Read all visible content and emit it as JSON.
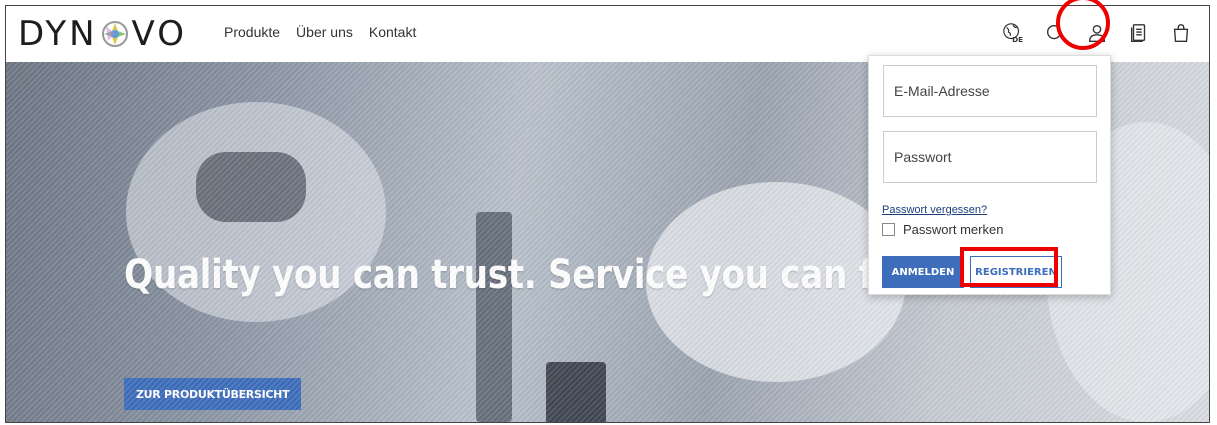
{
  "header": {
    "logo": {
      "text_left": "DYN",
      "text_right": "VO"
    },
    "nav": [
      {
        "label": "Produkte"
      },
      {
        "label": "Über uns"
      },
      {
        "label": "Kontakt"
      }
    ],
    "icons": [
      {
        "name": "language-globe-icon",
        "badge": "DE"
      },
      {
        "name": "search-icon"
      },
      {
        "name": "user-account-icon"
      },
      {
        "name": "wishlist-document-icon"
      },
      {
        "name": "shopping-bag-icon"
      }
    ]
  },
  "hero": {
    "title": "Quality you can trust. Service you can feel.",
    "cta_label": "ZUR PRODUKTÜBERSICHT"
  },
  "login_dropdown": {
    "email_placeholder": "E-Mail-Adresse",
    "password_placeholder": "Passwort",
    "forgot_link": "Passwort vergessen?",
    "remember_label": "Passwort merken",
    "login_button": "ANMELDEN",
    "register_button": "REGISTRIEREN"
  },
  "colors": {
    "brand_blue": "#3d6dbb",
    "highlight_red": "#e00000"
  }
}
